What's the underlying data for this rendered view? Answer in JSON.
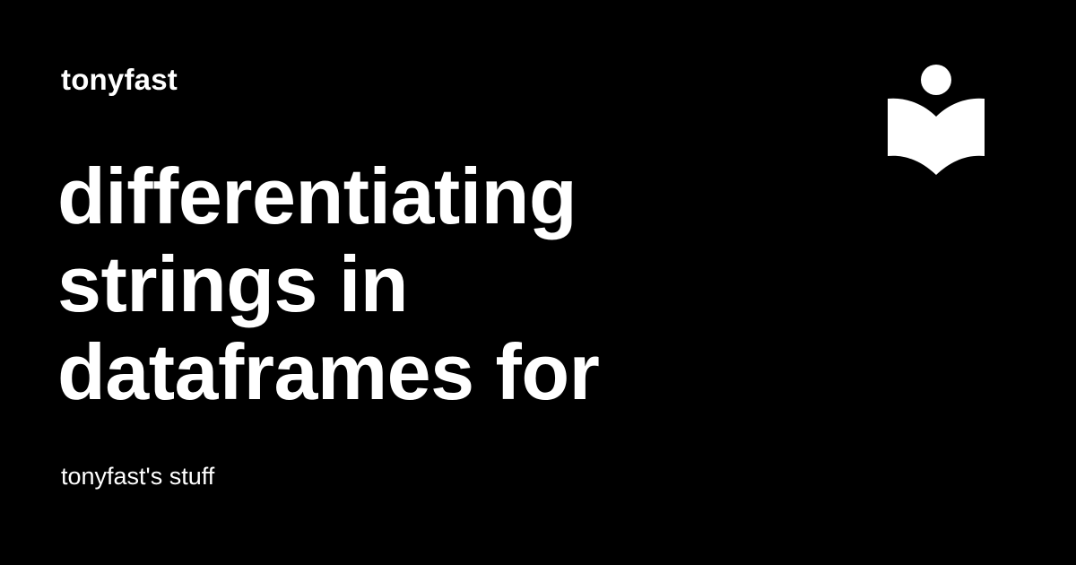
{
  "site": {
    "name": "tonyfast",
    "description": "tonyfast's stuff"
  },
  "page": {
    "title_lines": [
      "differentiating",
      "strings in",
      "dataframes for"
    ]
  },
  "colors": {
    "background": "#000000",
    "text": "#ffffff",
    "logo": "#ffffff"
  },
  "icons": {
    "logo": "reader-book-icon"
  }
}
